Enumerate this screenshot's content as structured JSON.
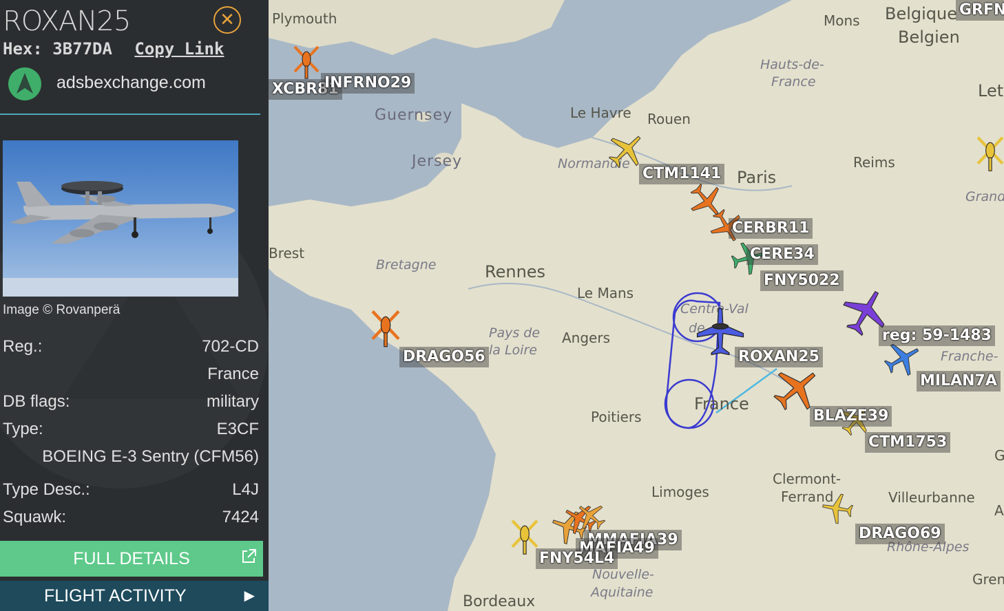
{
  "sidebar": {
    "callsign": "ROXAN25",
    "hex_label": "Hex:",
    "hex_value": "3B77DA",
    "copy_link": "Copy Link",
    "site_name": "adsbexchange.com",
    "photo_credit": "Image © Rovanperä",
    "rows": {
      "reg_label": "Reg.:",
      "reg_value": "702-CD",
      "country": "France",
      "db_flags_label": "DB flags:",
      "db_flags_value": "military",
      "type_label": "Type:",
      "type_value": "E3CF",
      "type_full": "BOEING E-3 Sentry (CFM56)",
      "type_desc_label": "Type Desc.:",
      "type_desc_value": "L4J",
      "squawk_label": "Squawk:",
      "squawk_value": "7424"
    },
    "full_details": "FULL DETAILS",
    "flight_activity": "FLIGHT ACTIVITY"
  },
  "map": {
    "places": {
      "plymouth": "Plymouth",
      "mons": "Mons",
      "belgique": "Belgique",
      "belgien": "Belgien",
      "hauts_de": "Hauts-de-",
      "france_region": "France",
      "letz": "Letz",
      "guernsey": "Guernsey",
      "jersey": "Jersey",
      "le_havre": "Le Havre",
      "rouen": "Rouen",
      "normandie": "Normandie",
      "paris": "Paris",
      "reims": "Reims",
      "grand": "Grand",
      "brest": "Brest",
      "bretagne": "Bretagne",
      "rennes": "Rennes",
      "le_mans": "Le Mans",
      "centre_val_1": "Centre-Val",
      "centre_val_2": "de",
      "pays_de": "Pays de",
      "la_loire": "la Loire",
      "angers": "Angers",
      "franche": "Franche-",
      "france_country": "France",
      "poitiers": "Poitiers",
      "clermont": "Clermont-",
      "ferrand": "Ferrand",
      "limoges": "Limoges",
      "villeurbanne": "Villeurbanne",
      "rhone": "Rhône-",
      "alpes": "Rhône-Alpes",
      "nouvelle": "Nouvelle-",
      "aquitaine": "Aquitaine",
      "bordeaux": "Bordeaux",
      "greno": "Greno",
      "g": "G",
      "a": "A"
    },
    "aircraft_labels": {
      "grfn": "GRFN",
      "xcbr81": "XCBR81",
      "infrno29": "INFRNO29",
      "ctm1141": "CTM1141",
      "cerbr11": "CERBR11",
      "cere34": "CERE34",
      "fny5022": "FNY5022",
      "reg_59": "reg: 59-1483",
      "milan7a": "MILAN7A",
      "drago56": "DRAGO56",
      "roxan25": "ROXAN25",
      "blaze39": "BLAZE39",
      "ctm1753": "CTM1753",
      "drago69": "DRAGO69",
      "mmafia39": "MMAFIA39",
      "mafia49": "MAFIA49",
      "fny54l4": "FNY54L4"
    }
  },
  "colors": {
    "orange": "#e8731f",
    "yellow": "#e8c33a",
    "green": "#3fae6a",
    "purple": "#7a3fd8",
    "blue": "#4a5ce0",
    "light_blue": "#3d7ee0",
    "accent": "#e9a23a"
  }
}
